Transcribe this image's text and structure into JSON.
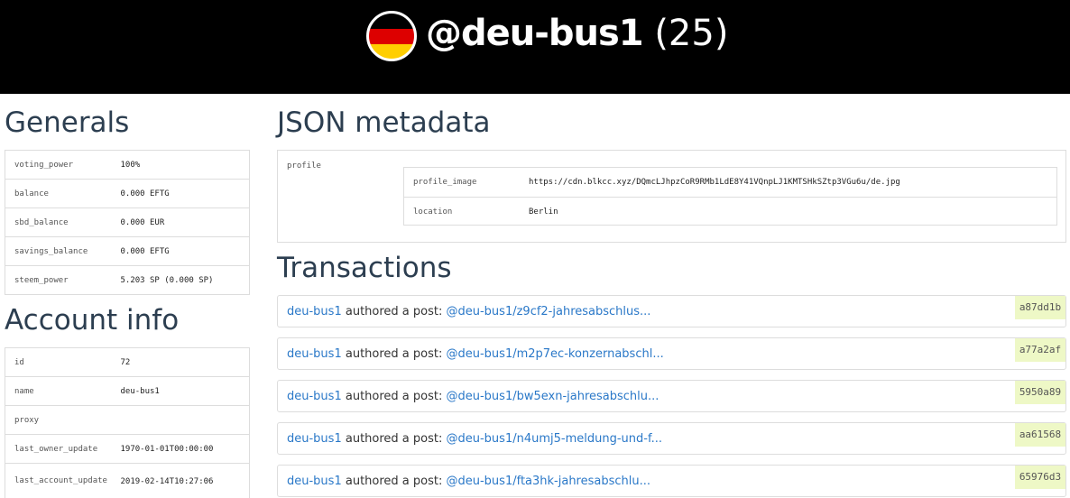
{
  "header": {
    "username": "@deu-bus1",
    "reputation": "(25)",
    "flag_colors": [
      "#000000",
      "#dd0000",
      "#ffce00"
    ]
  },
  "generals": {
    "title": "Generals",
    "rows": [
      {
        "key": "voting_power",
        "value": "100%"
      },
      {
        "key": "balance",
        "value": "0.000 EFTG"
      },
      {
        "key": "sbd_balance",
        "value": "0.000 EUR"
      },
      {
        "key": "savings_balance",
        "value": "0.000 EFTG"
      },
      {
        "key": "steem_power",
        "value": "5.203 SP (0.000 SP)"
      }
    ]
  },
  "account_info": {
    "title": "Account info",
    "rows": [
      {
        "key": "id",
        "value": "72"
      },
      {
        "key": "name",
        "value": "deu-bus1"
      },
      {
        "key": "proxy",
        "value": ""
      },
      {
        "key": "last_owner_update",
        "value": "1970-01-01T00:00:00"
      },
      {
        "key": "last_account_update",
        "value": "2019-02-14T10:27:06"
      }
    ]
  },
  "json_metadata": {
    "title": "JSON metadata",
    "outer_key": "profile",
    "rows": [
      {
        "key": "profile_image",
        "value": "https://cdn.blkcc.xyz/DQmcLJhpzCoR9RMb1LdE8Y41VQnpLJ1KMTSHkSZtp3VGu6u/de.jpg"
      },
      {
        "key": "location",
        "value": "Berlin"
      }
    ]
  },
  "transactions": {
    "title": "Transactions",
    "items": [
      {
        "author": "deu-bus1",
        "action": "authored a post:",
        "link": "@deu-bus1/z9cf2-jahresabschlus...",
        "hash": "a87dd1b"
      },
      {
        "author": "deu-bus1",
        "action": "authored a post:",
        "link": "@deu-bus1/m2p7ec-konzernabschl...",
        "hash": "a77a2af"
      },
      {
        "author": "deu-bus1",
        "action": "authored a post:",
        "link": "@deu-bus1/bw5exn-jahresabschlu...",
        "hash": "5950a89"
      },
      {
        "author": "deu-bus1",
        "action": "authored a post:",
        "link": "@deu-bus1/n4umj5-meldung-und-f...",
        "hash": "aa61568"
      },
      {
        "author": "deu-bus1",
        "action": "authored a post:",
        "link": "@deu-bus1/fta3hk-jahresabschlu...",
        "hash": "65976d3"
      }
    ]
  }
}
